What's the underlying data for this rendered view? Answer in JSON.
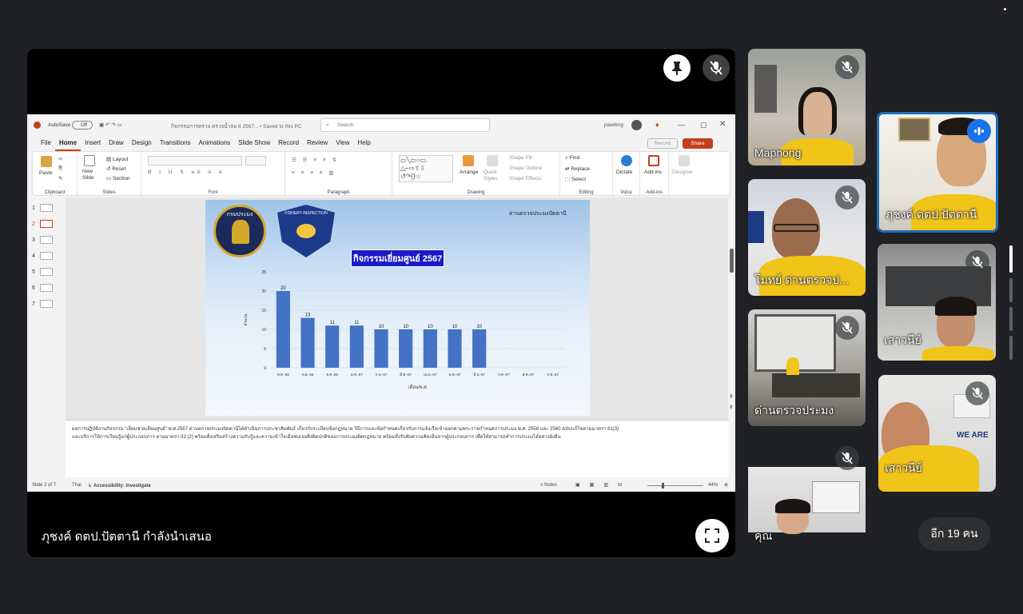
{
  "stage": {
    "presenter_label": "ภุชงค์ ดตป.ปัตตานี กำลังนำเสนอ",
    "pin_icon": "pin-icon",
    "mute_icon": "mic-off-icon",
    "fullscreen_icon": "fullscreen-icon"
  },
  "ppt": {
    "autosave": "AutoSave",
    "autosave_state": "Off",
    "doc_title": "กิจกรรมการตรวจ ตรวจน้ำลอ 6 2567...  •  Saved to this PC",
    "search_placeholder": "Search",
    "user": "pawiting",
    "record_button": "Record",
    "share_button": "Share",
    "menu": [
      "File",
      "Home",
      "Insert",
      "Draw",
      "Design",
      "Transitions",
      "Animations",
      "Slide Show",
      "Record",
      "Review",
      "View",
      "Help"
    ],
    "active_menu": "Home",
    "ribbon": {
      "clipboard": "Clipboard",
      "paste": "Paste",
      "slides": "Slides",
      "new_slide": "New Slide",
      "layout": "Layout",
      "reset": "Reset",
      "section": "Section",
      "font": "Font",
      "paragraph": "Paragraph",
      "drawing": "Drawing",
      "arrange": "Arrange",
      "quick_styles": "Quick Styles",
      "shape_fill": "Shape Fill",
      "shape_outline": "Shape Outline",
      "shape_effects": "Shape Effects",
      "editing": "Editing",
      "find": "Find",
      "replace": "Replace",
      "select": "Select",
      "voice": "Voice",
      "dictate": "Dictate",
      "addins": "Add-ins",
      "addins_btn": "Add-ins",
      "designer": "Designer"
    },
    "thumbnails": [
      "1",
      "2",
      "3",
      "4",
      "5",
      "6",
      "7"
    ],
    "active_thumbnail": 2,
    "notes_line1": "ผลการปฏิบัติงานกิจกรรม \"เยี่ยมช่วยเยี่ยมศูนย์\" พ.ศ.2567 ด่านตรวจประมงปัตตานีได้ดำเนินการประชาสัมพันธ์ เกี่ยวกับระเบียบข้อกฎหมาย วิธีการและข้อกำหนดเกี่ยวกับการแจ้งเรือเข้าออกตามพระราชกำหนดการประมง พ.ศ. 2558 และ 2560 ฉบับแก้ไขตามมาตรา 81(3)",
    "notes_line2": "และบริการให้การเรียนรู้แก่ผู้ประกอบการ ตามมาตรา 81 (2) พร้อมทั้งเสริมสร้างความรับรู้และความเข้าใจเมื่อพบเจอสิ่งผิดปกติของการประมงผิดกฎหมาย พร้อมทั้งรับฟังความคิดเห็นจากผู้ประกอบการ เพื่อให้สามารถทำการประมงได้อย่างยั่งยืน",
    "status_slide": "Slide 2 of 7",
    "status_lang": "Thai",
    "status_accessibility": "Accessibility: Investigate",
    "status_notes": "Notes",
    "status_zoom": "44%"
  },
  "slide": {
    "header_right": "ด่านตรวจประมงปัตตานี",
    "logo_left": "กรมประมง",
    "logo_right": "FISHERY INSPECTION",
    "title": "กิจกรรมเยี่ยมศูนย์ 2567"
  },
  "chart_data": {
    "type": "bar",
    "title": "กิจกรรมเยี่ยมศูนย์ 2567",
    "xlabel": "เดือน/พ.ศ.",
    "ylabel": "จำนวน",
    "ylim": [
      0,
      25
    ],
    "yticks": [
      0,
      5,
      10,
      15,
      20,
      25
    ],
    "categories": [
      "ต.ค.-66",
      "พ.ย.-66",
      "ธ.ค.-66",
      "ม.ค.-67",
      "ก.พ.-67",
      "มี.ค.-67",
      "เม.ย.-67",
      "พ.ค.-67",
      "มิ.ย.-67",
      "ก.ค.-67",
      "ส.ค.-67",
      "ก.ย.-67"
    ],
    "values": [
      20,
      13,
      11,
      11,
      10,
      10,
      10,
      10,
      10,
      null,
      null,
      null
    ],
    "bar_color": "#4472c4"
  },
  "participants": [
    {
      "name": "Mapnong",
      "muted": true
    },
    {
      "name": "ภุชงค์ ดตป.ปัตตานี",
      "muted": false,
      "speaking": true
    },
    {
      "name": "โมทย์ ด่านตรวจป...",
      "muted": true
    },
    {
      "name": "เสาวนีย์",
      "muted": true
    },
    {
      "name": "ด่านตรวจประมง",
      "muted": true
    },
    {
      "name": "เสาวนีย์",
      "muted": true
    },
    {
      "name": "คุณ",
      "muted": true
    }
  ],
  "more_people": "อีก 19 คน"
}
